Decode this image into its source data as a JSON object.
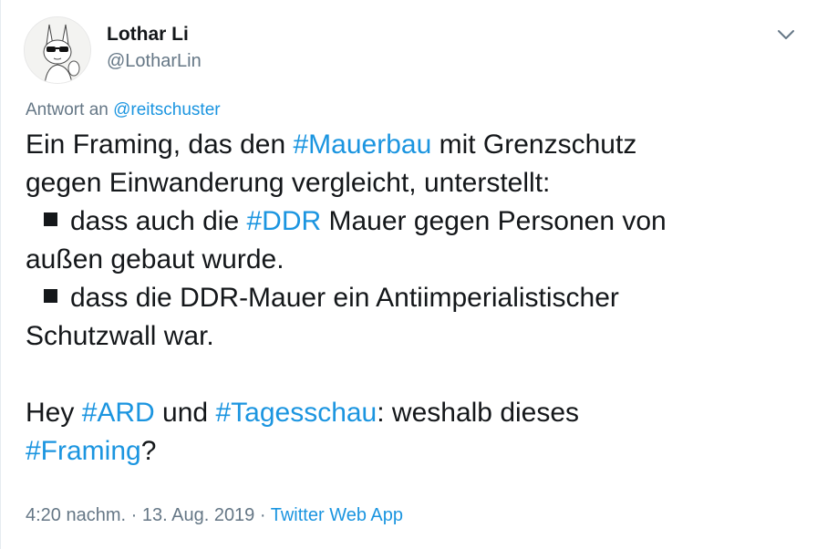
{
  "author": {
    "name": "Lothar Li",
    "handle": "@LotharLin"
  },
  "reply": {
    "prefix": "Antwort an",
    "mention": "@reitschuster"
  },
  "body": {
    "l1_a": "Ein Framing, das den ",
    "l1_tag": "#Mauerbau",
    "l1_b": " mit Grenzschutz",
    "l2": "gegen Einwanderung vergleicht, unterstellt:",
    "l3_a": "dass auch die ",
    "l3_tag": "#DDR",
    "l3_b": " Mauer gegen Personen von",
    "l4": "außen gebaut wurde.",
    "l5": "dass die DDR-Mauer ein Antiimperialistischer",
    "l6": "Schutzwall war.",
    "l8_a": "Hey ",
    "l8_tag1": "#ARD",
    "l8_b": " und ",
    "l8_tag2": "#Tagesschau",
    "l8_c": ": weshalb dieses",
    "l9_tag": "#Framing",
    "l9_b": "?"
  },
  "meta": {
    "time": "4:20 nachm.",
    "sep1": " · ",
    "date": "13. Aug. 2019",
    "sep2": " · ",
    "source": "Twitter Web App"
  },
  "icons": {
    "caret": "chevron-down-icon",
    "avatar": "avatar"
  },
  "colors": {
    "link": "#1b95e0",
    "secondary": "#657786",
    "text": "#14171a"
  }
}
